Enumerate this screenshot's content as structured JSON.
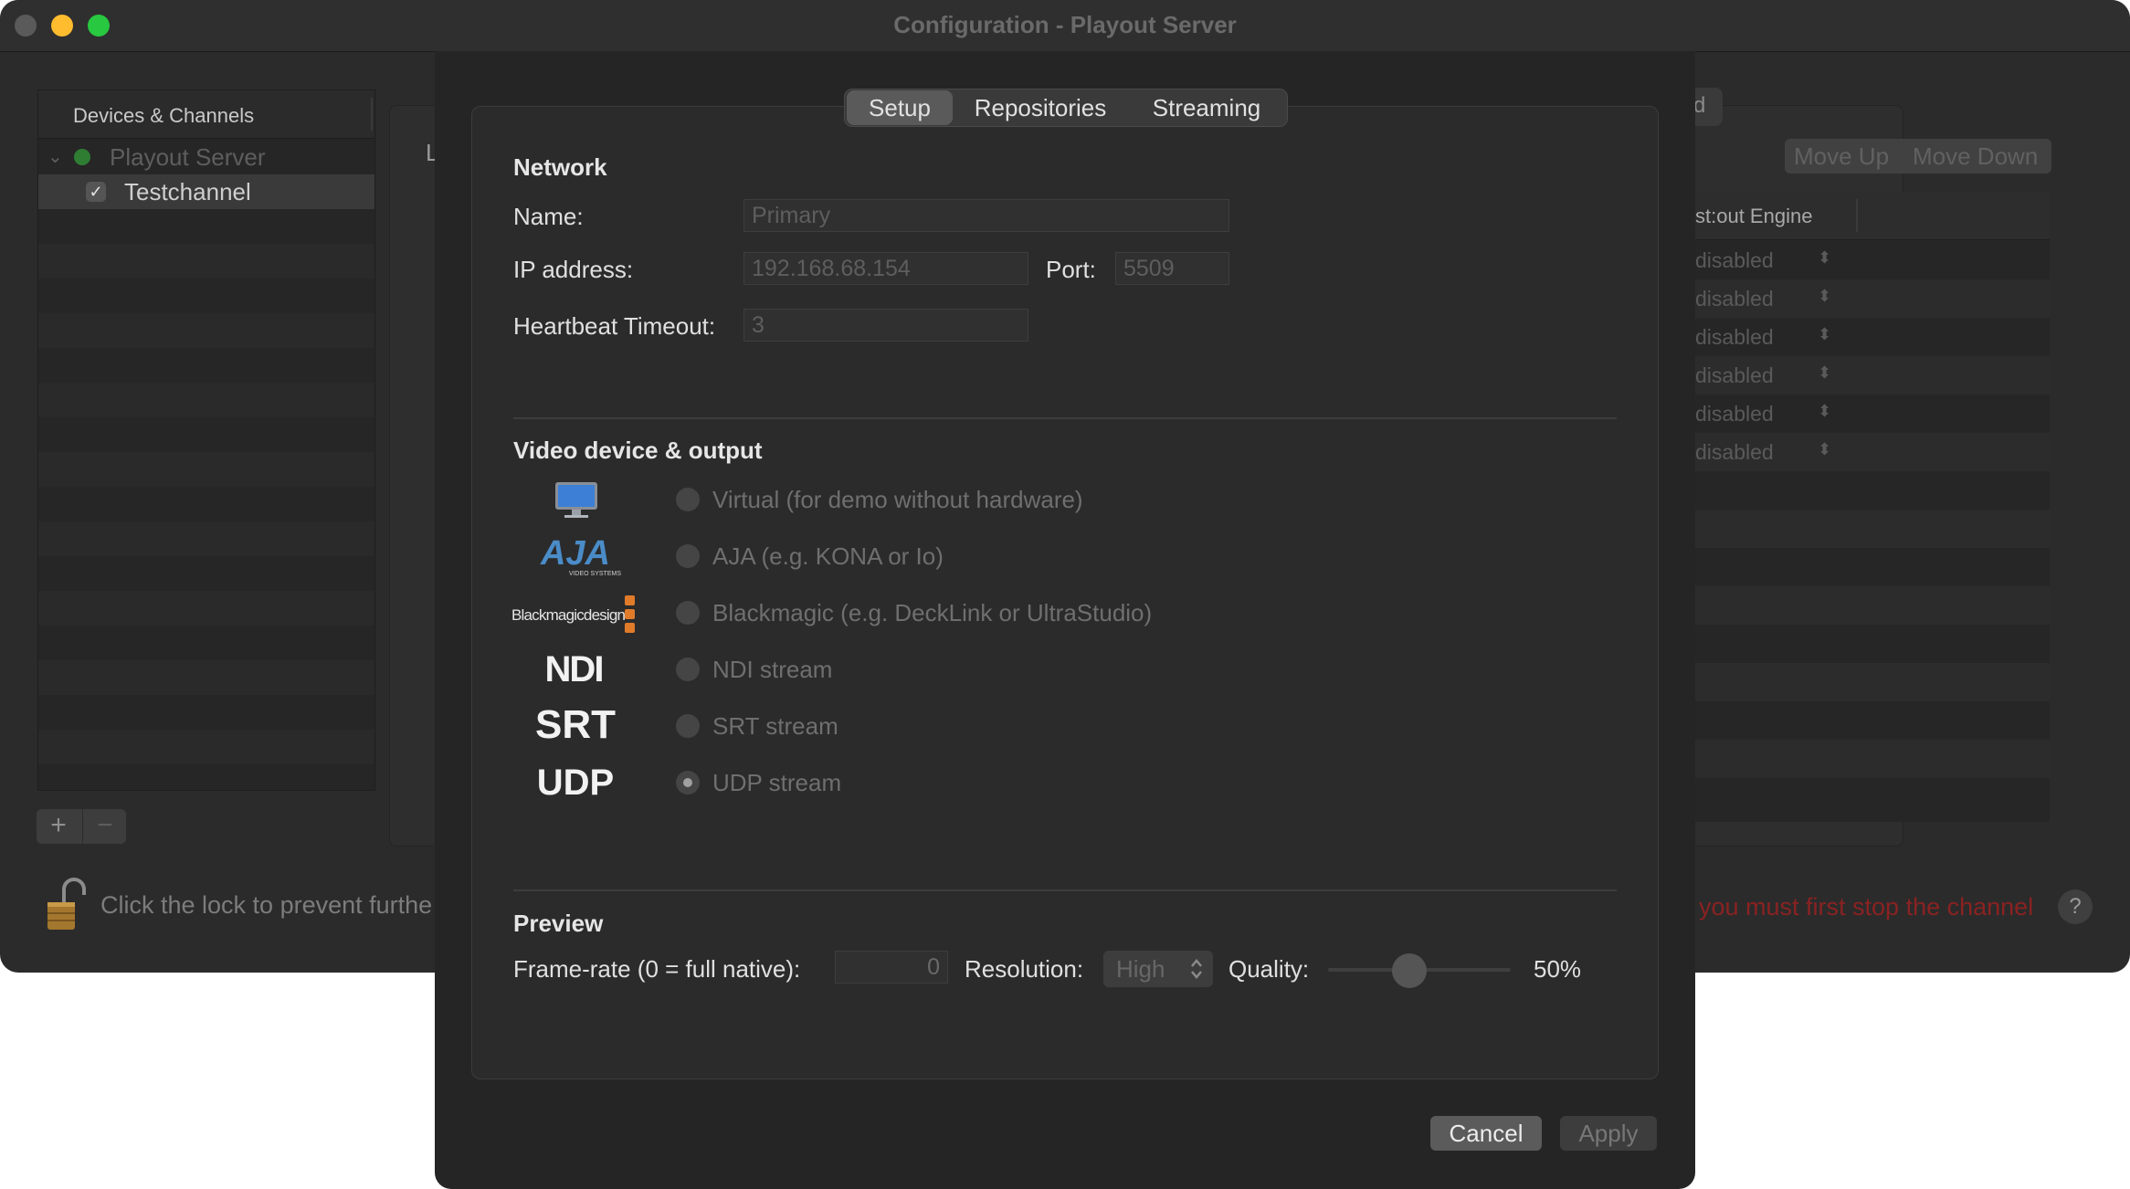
{
  "window": {
    "title": "Configuration - Playout Server"
  },
  "background": {
    "sidebar": {
      "header": "Devices & Channels",
      "server": "Playout Server",
      "channel": "Testchannel"
    },
    "add_label": "+",
    "remove_label": "−",
    "lock_text": "Click the lock to prevent furthe",
    "content_letter": "L",
    "tab_fragment": "d",
    "move_up": "Move Up",
    "move_down": "Move Down",
    "table": {
      "header": "st:out Engine",
      "rows": [
        "disabled",
        "disabled",
        "disabled",
        "disabled",
        "disabled",
        "disabled"
      ]
    },
    "warning": "you must first stop the channel",
    "help": "?"
  },
  "dialog": {
    "tabs": [
      "Setup",
      "Repositories",
      "Streaming"
    ],
    "network": {
      "title": "Network",
      "name_label": "Name:",
      "name_placeholder": "Primary",
      "ip_label": "IP address:",
      "ip_placeholder": "192.168.68.154",
      "port_label": "Port:",
      "port_placeholder": "5509",
      "heartbeat_label": "Heartbeat Timeout:",
      "heartbeat_placeholder": "3"
    },
    "video": {
      "title": "Video device & output",
      "options": [
        {
          "label": "Virtual (for demo without hardware)",
          "selected": false,
          "icon": "monitor-icon"
        },
        {
          "label": "AJA (e.g. KONA or Io)",
          "selected": false,
          "icon": "aja-logo"
        },
        {
          "label": "Blackmagic (e.g. DeckLink or UltraStudio)",
          "selected": false,
          "icon": "blackmagic-logo"
        },
        {
          "label": "NDI stream",
          "selected": false,
          "icon": "ndi-logo"
        },
        {
          "label": "SRT stream",
          "selected": false,
          "icon": "srt-logo"
        },
        {
          "label": "UDP stream",
          "selected": true,
          "icon": "udp-logo"
        }
      ],
      "logos": {
        "aja": "AJA",
        "aja_sub": "VIDEO SYSTEMS",
        "blackmagic": "Blackmagicdesign",
        "ndi": "NDI",
        "srt": "SRT",
        "udp": "UDP"
      }
    },
    "preview": {
      "title": "Preview",
      "framerate_label": "Frame-rate (0 = full native):",
      "framerate_value": "0",
      "resolution_label": "Resolution:",
      "resolution_value": "High",
      "quality_label": "Quality:",
      "quality_value": "50%",
      "quality_fraction": 0.5
    },
    "cancel": "Cancel",
    "apply": "Apply"
  },
  "colors": {
    "close": "#ff5f57",
    "minimize": "#febc2e",
    "zoom": "#28c840",
    "warning": "#8a2222"
  }
}
